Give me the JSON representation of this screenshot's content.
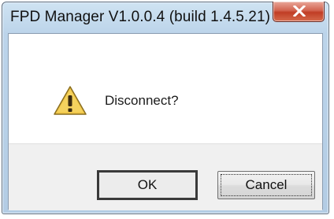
{
  "window": {
    "title": "FPD Manager V1.0.0.4 (build 1.4.5.21)"
  },
  "dialog": {
    "icon": "warning-icon",
    "message": "Disconnect?"
  },
  "buttons": {
    "ok_label": "OK",
    "cancel_label": "Cancel"
  },
  "colors": {
    "close_button": "#c03d25",
    "warning_icon": "#f2c94c",
    "footer_background": "#f0f0f0",
    "titlebar": "#bcd4ea"
  }
}
